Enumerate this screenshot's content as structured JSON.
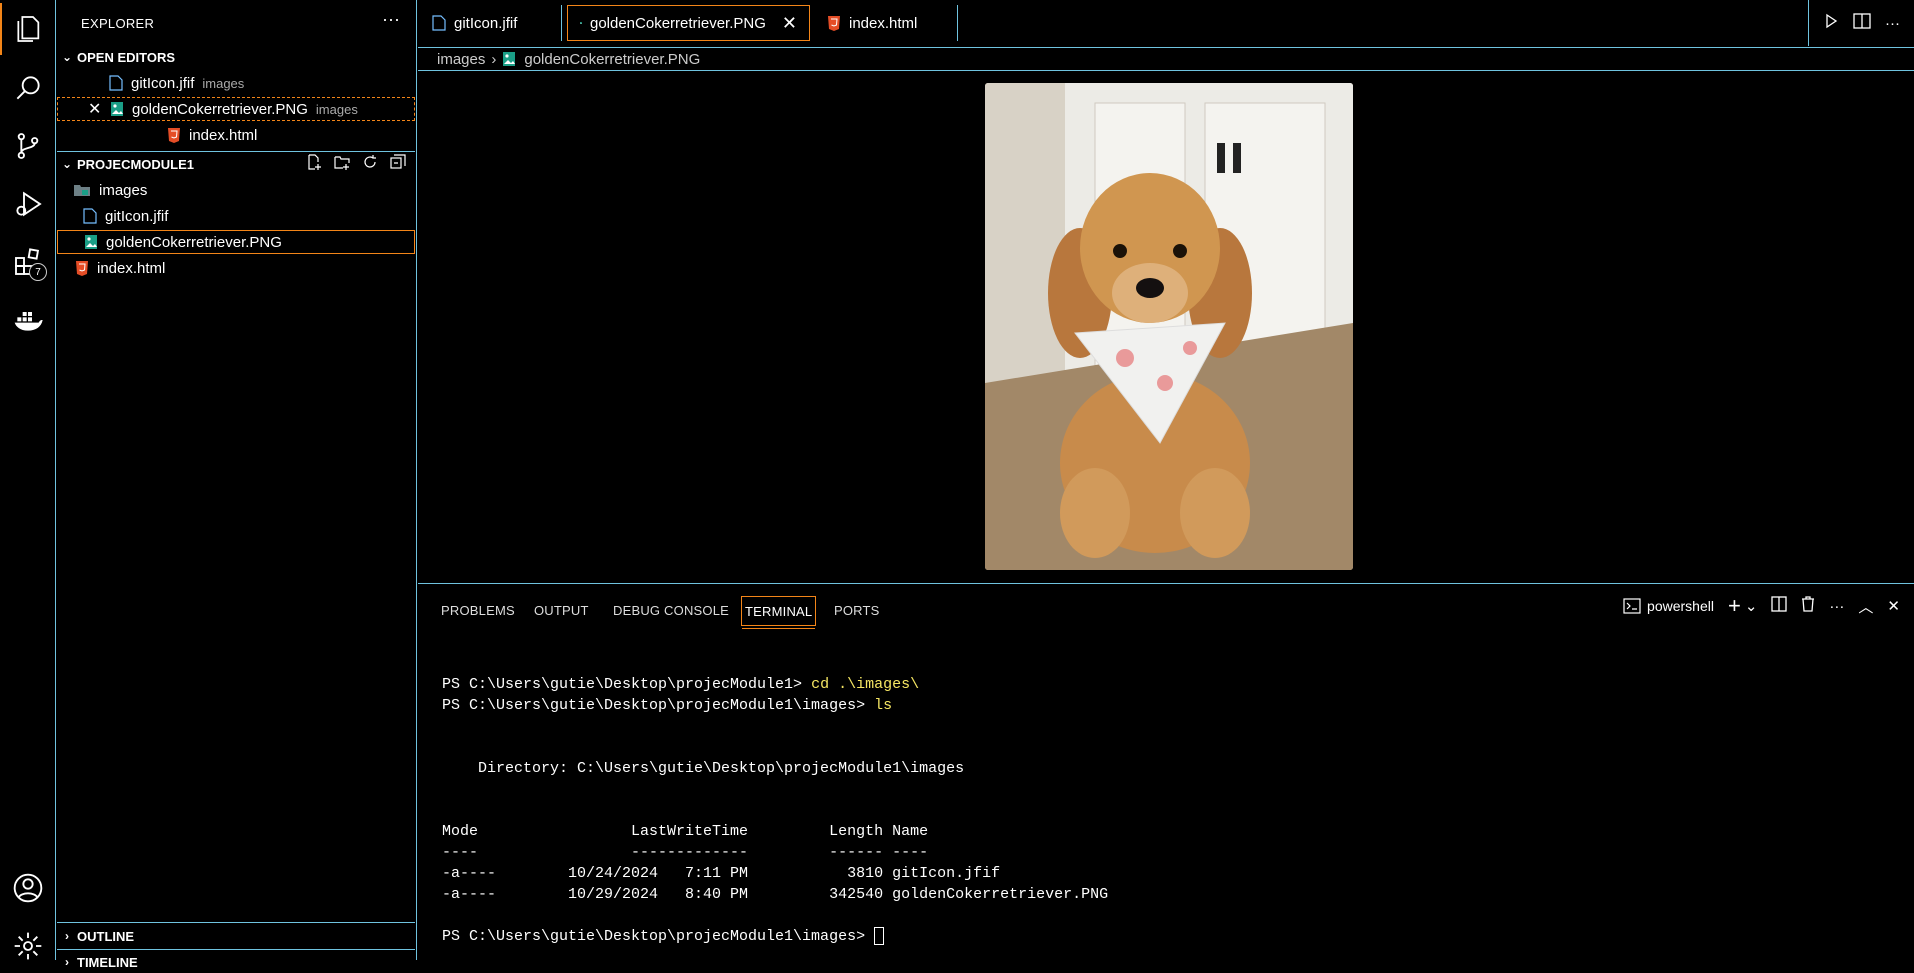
{
  "activity_bar": {
    "extensions_badge": "7"
  },
  "sidebar": {
    "title": "EXPLORER",
    "more": "···",
    "open_editors": {
      "label": "OPEN EDITORS",
      "items": [
        {
          "name": "gitIcon.jfif",
          "desc": "images"
        },
        {
          "name": "goldenCokerretriever.PNG",
          "desc": "images"
        },
        {
          "name": "index.html",
          "desc": ""
        }
      ]
    },
    "project": {
      "label": "PROJECMODULE1",
      "folder": "images",
      "files_in_folder": [
        "gitIcon.jfif",
        "goldenCokerretriever.PNG"
      ],
      "root_files": [
        "index.html"
      ]
    },
    "outline_label": "OUTLINE",
    "timeline_label": "TIMELINE"
  },
  "tabs": [
    {
      "label": "gitIcon.jfif"
    },
    {
      "label": "goldenCokerretriever.PNG"
    },
    {
      "label": "index.html"
    }
  ],
  "breadcrumb": {
    "folder": "images",
    "file": "goldenCokerretriever.PNG"
  },
  "panel": {
    "tabs": [
      "PROBLEMS",
      "OUTPUT",
      "DEBUG CONSOLE",
      "TERMINAL",
      "PORTS"
    ],
    "active_tab": "TERMINAL",
    "shell": "powershell"
  },
  "terminal": {
    "prompt1": "PS C:\\Users\\gutie\\Desktop\\projecModule1> ",
    "cmd1": "cd .\\images\\",
    "prompt2": "PS C:\\Users\\gutie\\Desktop\\projecModule1\\images> ",
    "cmd2": "ls",
    "directory_line": "    Directory: C:\\Users\\gutie\\Desktop\\projecModule1\\images",
    "header": "Mode                 LastWriteTime         Length Name",
    "underline": "----                 -------------         ------ ----",
    "rows": [
      "-a----        10/24/2024   7:11 PM           3810 gitIcon.jfif",
      "-a----        10/29/2024   8:40 PM         342540 goldenCokerretriever.PNG"
    ],
    "prompt3": "PS C:\\Users\\gutie\\Desktop\\projecModule1\\images> "
  },
  "colors": {
    "accent": "#f38518",
    "border": "#6fc3df",
    "background": "#000000"
  }
}
